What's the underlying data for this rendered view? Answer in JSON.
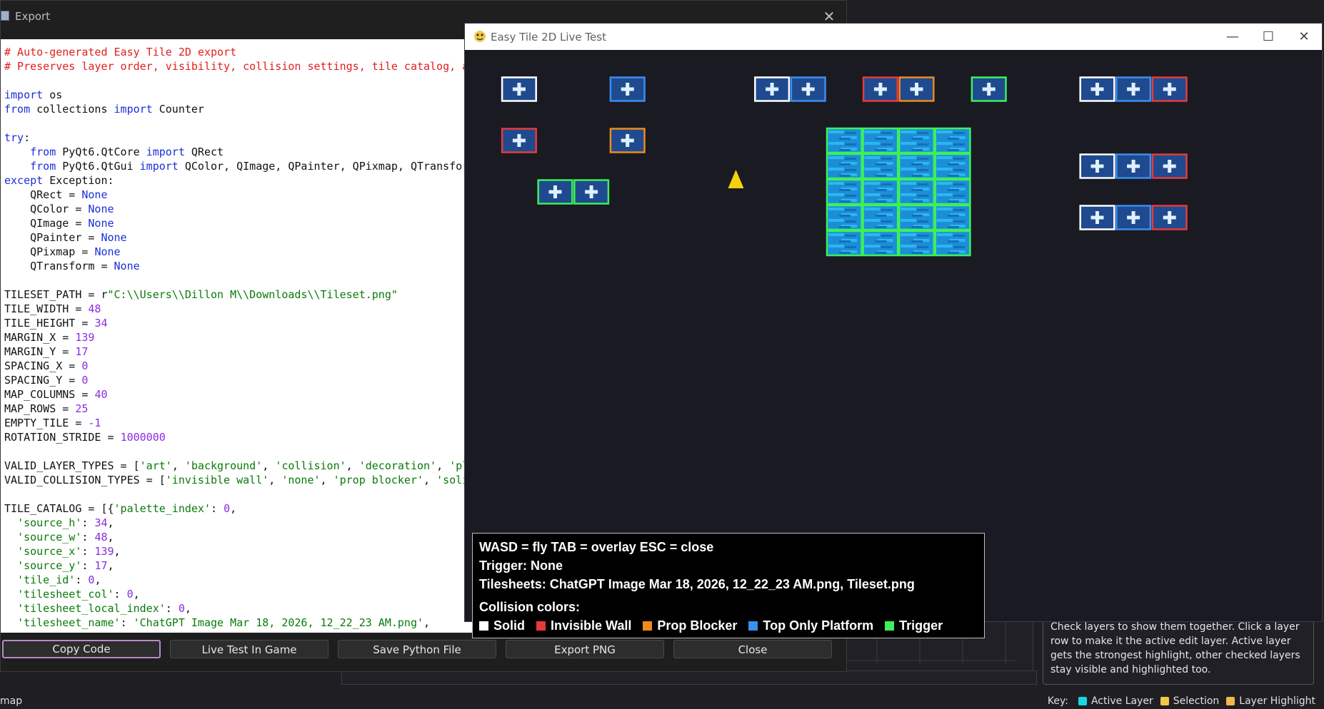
{
  "export_dialog": {
    "title": "Export",
    "close_glyph": "✕",
    "code_lines": [
      [
        {
          "t": "# Auto-generated Easy Tile 2D export",
          "c": "com"
        }
      ],
      [
        {
          "t": "# Preserves layer order, visibility, collision settings, tile catalog, an",
          "c": "com"
        }
      ],
      [],
      [
        {
          "t": "import",
          "c": "kw"
        },
        {
          "t": " os"
        }
      ],
      [
        {
          "t": "from",
          "c": "kw"
        },
        {
          "t": " collections "
        },
        {
          "t": "import",
          "c": "kw"
        },
        {
          "t": " Counter"
        }
      ],
      [],
      [
        {
          "t": "try",
          "c": "kw"
        },
        {
          "t": ":"
        }
      ],
      [
        {
          "t": "    "
        },
        {
          "t": "from",
          "c": "kw"
        },
        {
          "t": " PyQt6.QtCore "
        },
        {
          "t": "import",
          "c": "kw"
        },
        {
          "t": " QRect"
        }
      ],
      [
        {
          "t": "    "
        },
        {
          "t": "from",
          "c": "kw"
        },
        {
          "t": " PyQt6.QtGui "
        },
        {
          "t": "import",
          "c": "kw"
        },
        {
          "t": " QColor, QImage, QPainter, QPixmap, QTransfor"
        }
      ],
      [
        {
          "t": "except",
          "c": "kw"
        },
        {
          "t": " Exception:"
        }
      ],
      [
        {
          "t": "    QRect = "
        },
        {
          "t": "None",
          "c": "kw"
        }
      ],
      [
        {
          "t": "    QColor = "
        },
        {
          "t": "None",
          "c": "kw"
        }
      ],
      [
        {
          "t": "    QImage = "
        },
        {
          "t": "None",
          "c": "kw"
        }
      ],
      [
        {
          "t": "    QPainter = "
        },
        {
          "t": "None",
          "c": "kw"
        }
      ],
      [
        {
          "t": "    QPixmap = "
        },
        {
          "t": "None",
          "c": "kw"
        }
      ],
      [
        {
          "t": "    QTransform = "
        },
        {
          "t": "None",
          "c": "kw"
        }
      ],
      [],
      [
        {
          "t": "TILESET_PATH = r"
        },
        {
          "t": "\"C:\\\\Users\\\\Dillon M\\\\Downloads\\\\Tileset.png\"",
          "c": "str"
        }
      ],
      [
        {
          "t": "TILE_WIDTH = "
        },
        {
          "t": "48",
          "c": "num"
        }
      ],
      [
        {
          "t": "TILE_HEIGHT = "
        },
        {
          "t": "34",
          "c": "num"
        }
      ],
      [
        {
          "t": "MARGIN_X = "
        },
        {
          "t": "139",
          "c": "num"
        }
      ],
      [
        {
          "t": "MARGIN_Y = "
        },
        {
          "t": "17",
          "c": "num"
        }
      ],
      [
        {
          "t": "SPACING_X = "
        },
        {
          "t": "0",
          "c": "num"
        }
      ],
      [
        {
          "t": "SPACING_Y = "
        },
        {
          "t": "0",
          "c": "num"
        }
      ],
      [
        {
          "t": "MAP_COLUMNS = "
        },
        {
          "t": "40",
          "c": "num"
        }
      ],
      [
        {
          "t": "MAP_ROWS = "
        },
        {
          "t": "25",
          "c": "num"
        }
      ],
      [
        {
          "t": "EMPTY_TILE = "
        },
        {
          "t": "-1",
          "c": "num"
        }
      ],
      [
        {
          "t": "ROTATION_STRIDE = "
        },
        {
          "t": "1000000",
          "c": "num"
        }
      ],
      [],
      [
        {
          "t": "VALID_LAYER_TYPES = ["
        },
        {
          "t": "'art'",
          "c": "str"
        },
        {
          "t": ", "
        },
        {
          "t": "'background'",
          "c": "str"
        },
        {
          "t": ", "
        },
        {
          "t": "'collision'",
          "c": "str"
        },
        {
          "t": ", "
        },
        {
          "t": "'decoration'",
          "c": "str"
        },
        {
          "t": ", "
        },
        {
          "t": "'pl",
          "c": "str"
        }
      ],
      [
        {
          "t": "VALID_COLLISION_TYPES = ["
        },
        {
          "t": "'invisible wall'",
          "c": "str"
        },
        {
          "t": ", "
        },
        {
          "t": "'none'",
          "c": "str"
        },
        {
          "t": ", "
        },
        {
          "t": "'prop blocker'",
          "c": "str"
        },
        {
          "t": ", "
        },
        {
          "t": "'soli",
          "c": "str"
        }
      ],
      [],
      [
        {
          "t": "TILE_CATALOG = [{"
        },
        {
          "t": "'palette_index'",
          "c": "str"
        },
        {
          "t": ": "
        },
        {
          "t": "0",
          "c": "num"
        },
        {
          "t": ","
        }
      ],
      [
        {
          "t": "  "
        },
        {
          "t": "'source_h'",
          "c": "str"
        },
        {
          "t": ": "
        },
        {
          "t": "34",
          "c": "num"
        },
        {
          "t": ","
        }
      ],
      [
        {
          "t": "  "
        },
        {
          "t": "'source_w'",
          "c": "str"
        },
        {
          "t": ": "
        },
        {
          "t": "48",
          "c": "num"
        },
        {
          "t": ","
        }
      ],
      [
        {
          "t": "  "
        },
        {
          "t": "'source_x'",
          "c": "str"
        },
        {
          "t": ": "
        },
        {
          "t": "139",
          "c": "num"
        },
        {
          "t": ","
        }
      ],
      [
        {
          "t": "  "
        },
        {
          "t": "'source_y'",
          "c": "str"
        },
        {
          "t": ": "
        },
        {
          "t": "17",
          "c": "num"
        },
        {
          "t": ","
        }
      ],
      [
        {
          "t": "  "
        },
        {
          "t": "'tile_id'",
          "c": "str"
        },
        {
          "t": ": "
        },
        {
          "t": "0",
          "c": "num"
        },
        {
          "t": ","
        }
      ],
      [
        {
          "t": "  "
        },
        {
          "t": "'tilesheet_col'",
          "c": "str"
        },
        {
          "t": ": "
        },
        {
          "t": "0",
          "c": "num"
        },
        {
          "t": ","
        }
      ],
      [
        {
          "t": "  "
        },
        {
          "t": "'tilesheet_local_index'",
          "c": "str"
        },
        {
          "t": ": "
        },
        {
          "t": "0",
          "c": "num"
        },
        {
          "t": ","
        }
      ],
      [
        {
          "t": "  "
        },
        {
          "t": "'tilesheet_name'",
          "c": "str"
        },
        {
          "t": ": "
        },
        {
          "t": "'ChatGPT Image Mar 18, 2026, 12_22_23 AM.png'",
          "c": "str"
        },
        {
          "t": ","
        }
      ]
    ],
    "buttons": {
      "copy_code": "Copy Code",
      "live_test": "Live Test In Game",
      "save_python": "Save Python File",
      "export_png": "Export PNG",
      "close": "Close"
    }
  },
  "live_test": {
    "title": "Easy Tile 2D Live Test",
    "minimize_glyph": "—",
    "maximize_glyph": "☐",
    "close_glyph": "✕",
    "hud": {
      "controls": "WASD = fly   TAB = overlay   ESC = close",
      "trigger": "Trigger: None",
      "tilesheets": "Tilesheets: ChatGPT Image Mar 18, 2026, 12_22_23 AM.png, Tileset.png",
      "collision_heading": "Collision colors:",
      "collision_types": [
        {
          "label": "Solid",
          "color": "#ffffff"
        },
        {
          "label": "Invisible Wall",
          "color": "#e83a3a"
        },
        {
          "label": "Prop Blocker",
          "color": "#f08a1a"
        },
        {
          "label": "Top Only Platform",
          "color": "#3a8ff0"
        },
        {
          "label": "Trigger",
          "color": "#3cf05a"
        }
      ]
    },
    "tiles": [
      {
        "col": 1,
        "row": 1,
        "border": "#ffffff"
      },
      {
        "col": 4,
        "row": 1,
        "border": "#3a8ff0"
      },
      {
        "col": 8,
        "row": 1,
        "border": "#ffffff"
      },
      {
        "col": 9,
        "row": 1,
        "border": "#3a8ff0"
      },
      {
        "col": 11,
        "row": 1,
        "border": "#e83a3a"
      },
      {
        "col": 12,
        "row": 1,
        "border": "#f08a1a"
      },
      {
        "col": 14,
        "row": 1,
        "border": "#3cf05a"
      },
      {
        "col": 17,
        "row": 1,
        "border": "#ffffff"
      },
      {
        "col": 18,
        "row": 1,
        "border": "#3a8ff0"
      },
      {
        "col": 19,
        "row": 1,
        "border": "#e83a3a"
      },
      {
        "col": 1,
        "row": 3,
        "border": "#e83a3a"
      },
      {
        "col": 4,
        "row": 3,
        "border": "#f08a1a"
      },
      {
        "col": 2,
        "row": 5,
        "border": "#3cf05a"
      },
      {
        "col": 3,
        "row": 5,
        "border": "#3cf05a"
      },
      {
        "col": 17,
        "row": 4,
        "border": "#ffffff"
      },
      {
        "col": 18,
        "row": 4,
        "border": "#3a8ff0"
      },
      {
        "col": 19,
        "row": 4,
        "border": "#e83a3a"
      },
      {
        "col": 17,
        "row": 6,
        "border": "#ffffff"
      },
      {
        "col": 18,
        "row": 6,
        "border": "#3a8ff0"
      },
      {
        "col": 19,
        "row": 6,
        "border": "#e83a3a"
      }
    ],
    "water_block": {
      "col": 10,
      "row": 3,
      "cols": 4,
      "rows": 5,
      "border": "#3cf05a"
    },
    "player": {
      "col": 7,
      "row": 5
    }
  },
  "editor_background": {
    "help_text": "Check layers to show them together. Click a layer row to make it the active edit layer. Active layer gets the strongest highlight, other checked layers stay visible and highlighted too.",
    "status_left": "map",
    "key_label": "Key:",
    "key_items": [
      {
        "label": "Active Layer",
        "color": "#19d6e0"
      },
      {
        "label": "Selection",
        "color": "#f2c84b"
      },
      {
        "label": "Layer Highlight",
        "color": "#f2b84b"
      }
    ]
  }
}
